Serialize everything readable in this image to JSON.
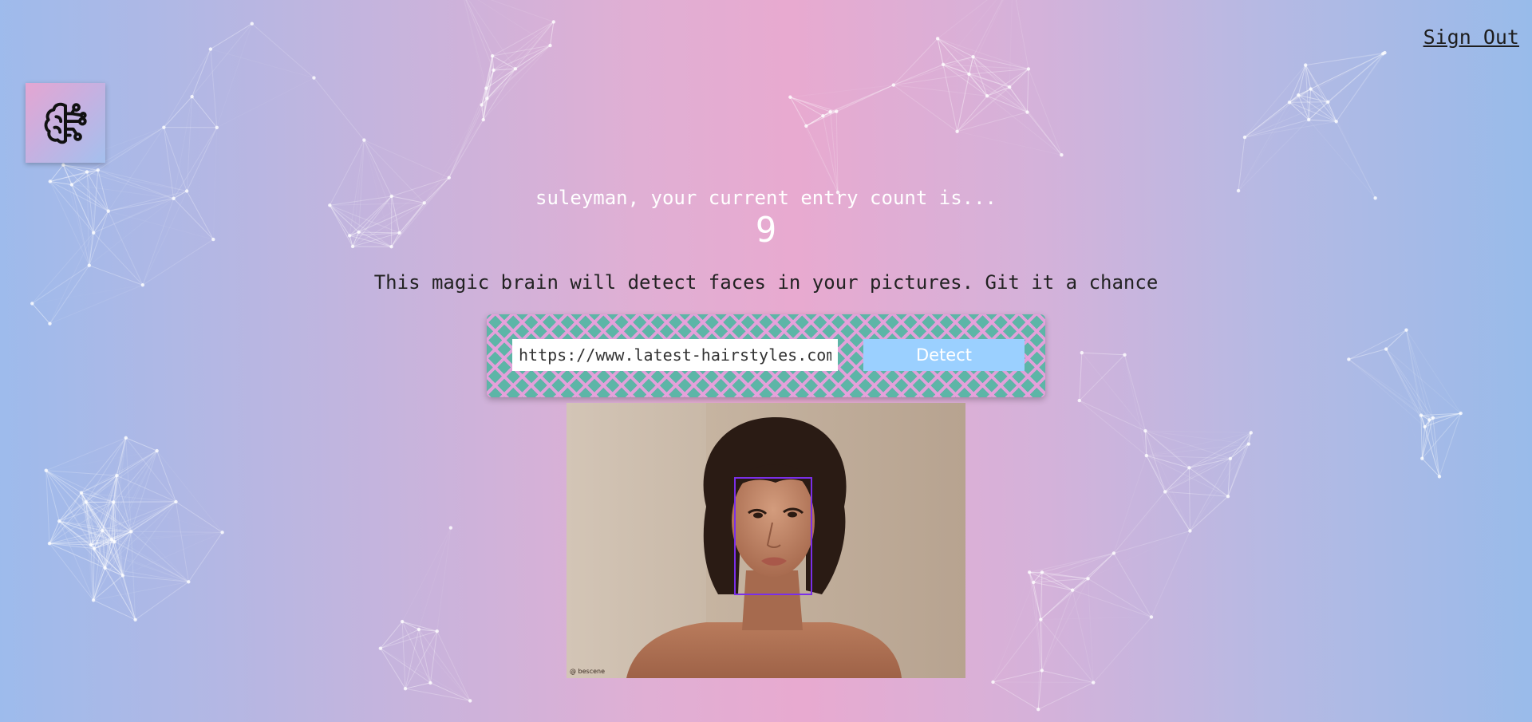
{
  "header": {
    "sign_out_label": "Sign Out"
  },
  "logo": {
    "icon": "brain-circuit-icon"
  },
  "entry": {
    "greeting": "suleyman, your current entry count is...",
    "count": "9"
  },
  "tagline": "This magic brain will detect faces in your pictures. Git it a chance",
  "form": {
    "url_value": "https://www.latest-hairstyles.com/wp-",
    "detect_label": "Detect"
  },
  "result": {
    "watermark": "@ bescene"
  },
  "colors": {
    "form_teal": "#5db5a7",
    "form_pattern": "#e8a0dc",
    "detect_button": "#9bd0ff",
    "face_box": "#7a2fe8"
  }
}
